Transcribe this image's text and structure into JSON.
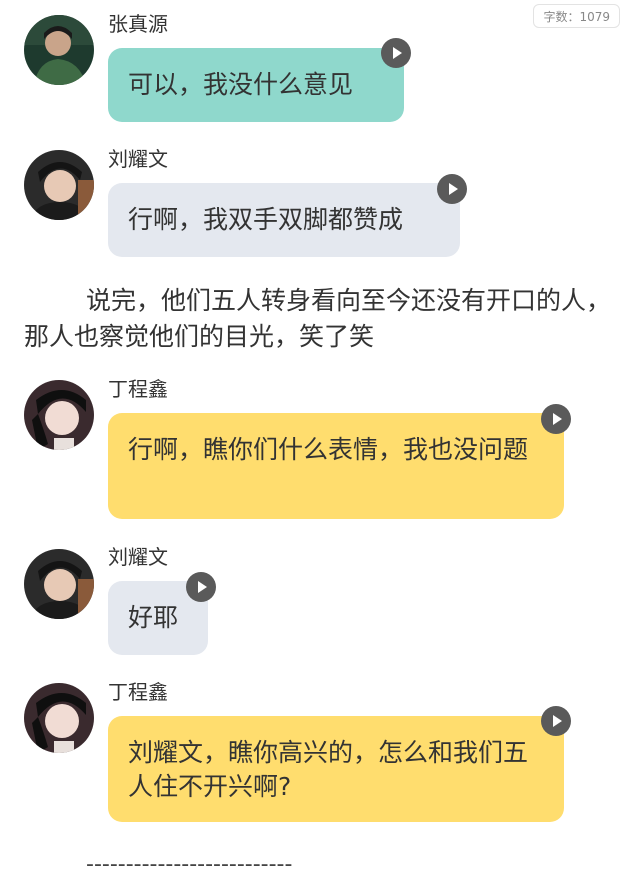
{
  "word_count_badge": "字数：1079",
  "colors": {
    "teal_bubble": "#8fd8cc",
    "gray_bubble": "#e4e8ef",
    "yellow_bubble": "#ffdd6e",
    "play_button": "#5a5a5a"
  },
  "messages": [
    {
      "sender": "张真源",
      "text": "可以，我没什么意见",
      "bubble": "teal"
    },
    {
      "sender": "刘耀文",
      "text": "行啊，我双手双脚都赞成",
      "bubble": "gray"
    },
    {
      "sender": "丁程鑫",
      "text": "行啊，瞧你们什么表情，我也没问题",
      "bubble": "yellow"
    },
    {
      "sender": "刘耀文",
      "text": "好耶",
      "bubble": "gray"
    },
    {
      "sender": "丁程鑫",
      "text": "刘耀文，瞧你高兴的，怎么和我们五人住不开兴啊?",
      "bubble": "yellow"
    }
  ],
  "narration": "说完，他们五人转身看向至今还没有开口的人，那人也察觉他们的目光，笑了笑",
  "divider": "--------------------------",
  "icons": {
    "avatar": "avatar-photo",
    "play": "play-icon"
  }
}
